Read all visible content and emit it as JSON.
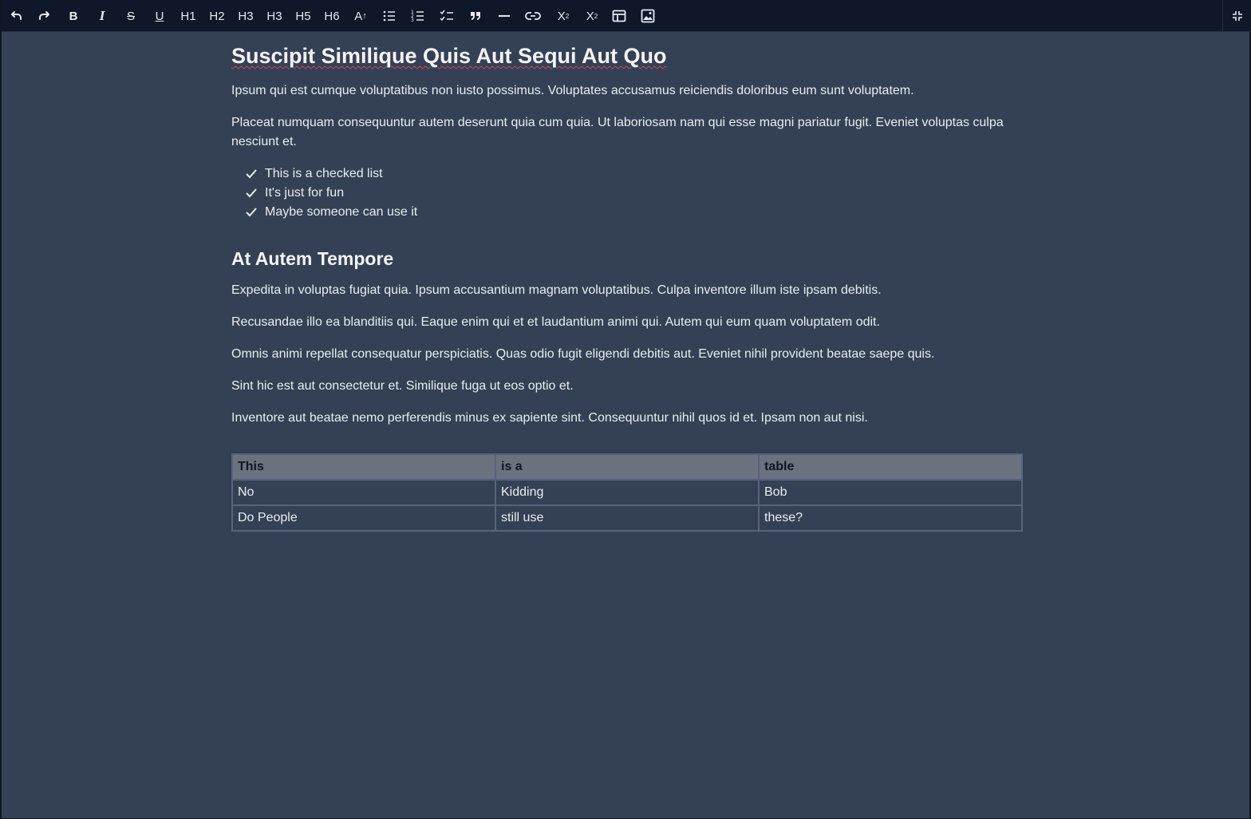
{
  "toolbar": {
    "buttons": [
      {
        "name": "undo-icon",
        "label": ""
      },
      {
        "name": "redo-icon",
        "label": ""
      },
      {
        "name": "bold-icon",
        "label": "B"
      },
      {
        "name": "italic-icon",
        "label": "I"
      },
      {
        "name": "strikethrough-icon",
        "label": "S"
      },
      {
        "name": "underline-icon",
        "label": "U"
      },
      {
        "name": "heading-1",
        "label": "H1"
      },
      {
        "name": "heading-2",
        "label": "H2"
      },
      {
        "name": "heading-3",
        "label": "H3"
      },
      {
        "name": "heading-4",
        "label": "H3"
      },
      {
        "name": "heading-5",
        "label": "H5"
      },
      {
        "name": "heading-6",
        "label": "H6"
      },
      {
        "name": "font-size-icon",
        "label": "A"
      },
      {
        "name": "bullet-list-icon",
        "label": ""
      },
      {
        "name": "ordered-list-icon",
        "label": ""
      },
      {
        "name": "check-list-icon",
        "label": ""
      },
      {
        "name": "quote-icon",
        "label": ""
      },
      {
        "name": "horizontal-rule-icon",
        "label": ""
      },
      {
        "name": "link-icon",
        "label": ""
      },
      {
        "name": "superscript-icon",
        "label": "X"
      },
      {
        "name": "subscript-icon",
        "label": "X"
      },
      {
        "name": "table-icon",
        "label": ""
      },
      {
        "name": "image-icon",
        "label": ""
      },
      {
        "name": "exit-fullscreen-icon",
        "label": ""
      }
    ]
  },
  "document": {
    "title": "Suscipit Similique Quis Aut Sequi Aut Quo",
    "paragraphs_1": [
      "Ipsum qui est cumque voluptatibus non iusto possimus. Voluptates accusamus reiciendis doloribus eum sunt voluptatem.",
      "Placeat numquam consequuntur autem deserunt quia cum quia. Ut laboriosam nam qui esse magni pariatur fugit. Eveniet voluptas culpa nesciunt et."
    ],
    "checklist": [
      "This is a checked list",
      "It's just for fun",
      "Maybe someone can use it"
    ],
    "subtitle": "At Autem Tempore",
    "paragraphs_2": [
      "Expedita in voluptas fugiat quia. Ipsum accusantium magnam voluptatibus. Culpa inventore illum iste ipsam debitis.",
      "Recusandae illo ea blanditiis qui. Eaque enim qui et et laudantium animi qui. Autem qui eum quam voluptatem odit.",
      "Omnis animi repellat consequatur perspiciatis. Quas odio fugit eligendi debitis aut. Eveniet nihil provident beatae saepe quis.",
      "Sint hic est aut consectetur et. Similique fuga ut eos optio et.",
      "Inventore aut beatae nemo perferendis minus ex sapiente sint. Consequuntur nihil quos id et. Ipsam non aut nisi."
    ],
    "table": {
      "headers": [
        "This",
        "is a",
        "table"
      ],
      "rows": [
        [
          "No",
          "Kidding",
          "Bob"
        ],
        [
          "Do People",
          "still use",
          "these?"
        ]
      ]
    }
  }
}
